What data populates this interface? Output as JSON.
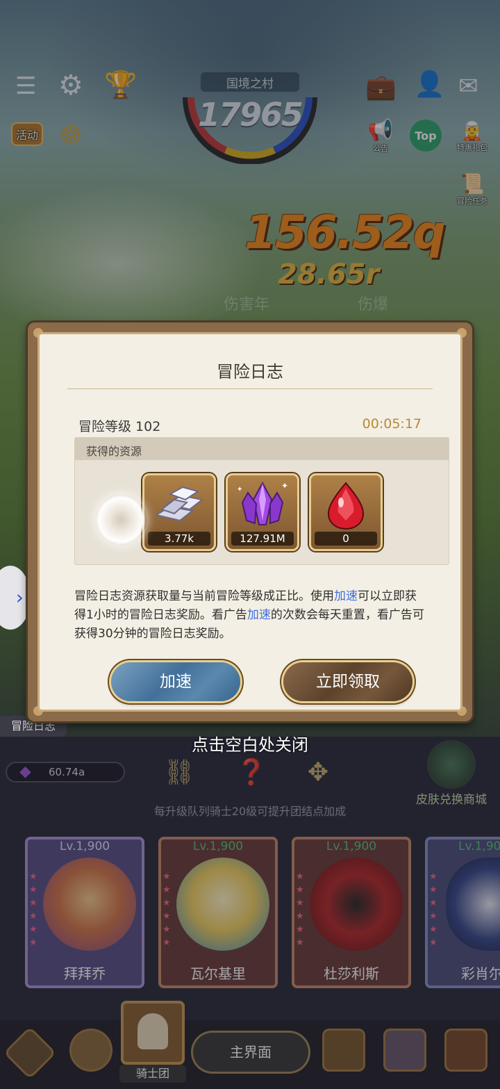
{
  "hud": {
    "region_name": "国境之村",
    "region_score": "17965",
    "event_label": "活动",
    "notice_label": "公告",
    "top_label": "Top",
    "special_label": "特惠礼包",
    "quest_label": "冒险任务"
  },
  "floating": {
    "damage_big": "156.52q",
    "damage_small": "28.65r",
    "ghost_text": "伤害年",
    "ghost_text2": "伤爆"
  },
  "modal": {
    "title": "冒险日志",
    "level_label": "冒险等级 102",
    "timer": "00:05:17",
    "resources_title": "获得的资源",
    "resources": [
      {
        "icon": "silver-ingot-icon",
        "count": "3.77k"
      },
      {
        "icon": "purple-crystal-icon",
        "count": "127.91M"
      },
      {
        "icon": "red-gem-icon",
        "count": "0"
      }
    ],
    "desc_part1": "冒险日志资源获取量与当前冒险等级成正比。使用",
    "desc_link1": "加速",
    "desc_part2": "可以立即获得1小时的冒险日志奖励。看广告",
    "desc_link2": "加速",
    "desc_part3": "的次数会每天重置，看广告可获得30分钟的冒险日志奖励。",
    "speed_button": "加速",
    "claim_button": "立即领取"
  },
  "close_hint": "点击空白处关闭",
  "side_tab": "冒险日志",
  "lower": {
    "crystal_value": "60.74a",
    "skin_shop_label": "皮肤兑换商城",
    "hint": "每升级队列骑士20级可提升团结点加成",
    "cards": [
      {
        "level": "Lv.1,900",
        "name": "拜拜乔"
      },
      {
        "level": "Lv.1,900",
        "name": "瓦尔基里"
      },
      {
        "level": "Lv.1,900",
        "name": "杜莎利斯"
      },
      {
        "level": "Lv.1,900",
        "name": "彩肖尔"
      }
    ]
  },
  "nav": {
    "knights_label": "骑士团",
    "home_label": "主界面"
  },
  "colors": {
    "link": "#3d6fe0",
    "timer": "#b58a3a",
    "level_green": "#57c27a"
  }
}
